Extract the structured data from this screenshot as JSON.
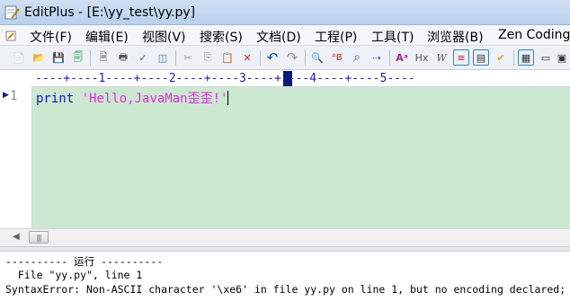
{
  "window": {
    "title": "EditPlus - [E:\\yy_test\\yy.py]"
  },
  "menu": {
    "items": [
      {
        "label": "文件(F)"
      },
      {
        "label": "编辑(E)"
      },
      {
        "label": "视图(V)"
      },
      {
        "label": "搜索(S)"
      },
      {
        "label": "文档(D)"
      },
      {
        "label": "工程(P)"
      },
      {
        "label": "工具(T)"
      },
      {
        "label": "浏览器(B)"
      },
      {
        "label": "Zen Coding"
      }
    ]
  },
  "toolbar": {
    "buttons": [
      {
        "icon": "new-file-icon",
        "glyph": "📄"
      },
      {
        "icon": "open-folder-icon",
        "glyph": "📂"
      },
      {
        "icon": "save-icon",
        "glyph": "💾"
      },
      {
        "icon": "save-all-icon",
        "glyph": "🗐"
      },
      {
        "icon": "print-preview-icon",
        "glyph": "🗎"
      },
      {
        "icon": "print-icon",
        "glyph": "🖶"
      },
      {
        "icon": "spell-check-icon",
        "glyph": "✓"
      },
      {
        "icon": "browser-preview-icon",
        "glyph": "◫"
      },
      {
        "icon": "cut-icon",
        "glyph": "✂"
      },
      {
        "icon": "copy-icon",
        "glyph": "⎘"
      },
      {
        "icon": "paste-icon",
        "glyph": "📋"
      },
      {
        "icon": "delete-icon",
        "glyph": "✕"
      },
      {
        "icon": "undo-icon",
        "glyph": "↶"
      },
      {
        "icon": "redo-icon",
        "glyph": "↷"
      },
      {
        "icon": "find-icon",
        "glyph": "🔍"
      },
      {
        "icon": "replace-icon",
        "glyph": "ᴬB"
      },
      {
        "icon": "find-in-files-icon",
        "glyph": "⌕"
      },
      {
        "icon": "goto-icon",
        "glyph": "⇢"
      },
      {
        "icon": "font-icon",
        "glyph": "Aᵃ"
      },
      {
        "icon": "hex-icon",
        "glyph": "Hx"
      },
      {
        "icon": "word-wrap-icon",
        "glyph": "W"
      },
      {
        "icon": "line-number-toggle-icon",
        "glyph": "≡"
      },
      {
        "icon": "column-ruler-icon",
        "glyph": "▤"
      },
      {
        "icon": "spell-toggle-icon",
        "glyph": "✔"
      },
      {
        "icon": "directory-window-icon",
        "glyph": "▦"
      },
      {
        "icon": "output-window-icon",
        "glyph": "▭"
      },
      {
        "icon": "fullscreen-icon",
        "glyph": "▣"
      }
    ]
  },
  "ruler": {
    "text": "----+----1----+----2----+----3----+----4----+----5----"
  },
  "editor": {
    "line_marker": "▶",
    "line_number": "1",
    "keyword": "print",
    "string": "'Hello,JavaMan歪歪!'",
    "background": "#cde8d1",
    "keyword_color": "#1616c9",
    "string_color": "#e02ae0"
  },
  "scrollbar": {
    "left_arrow": "◀",
    "thumb_grip": "|||"
  },
  "output": {
    "lines": [
      "---------- 运行 ----------",
      "  File \"yy.py\", line 1",
      "SyntaxError: Non-ASCII character '\\xe6' in file yy.py on line 1, but no encoding declared;"
    ]
  }
}
